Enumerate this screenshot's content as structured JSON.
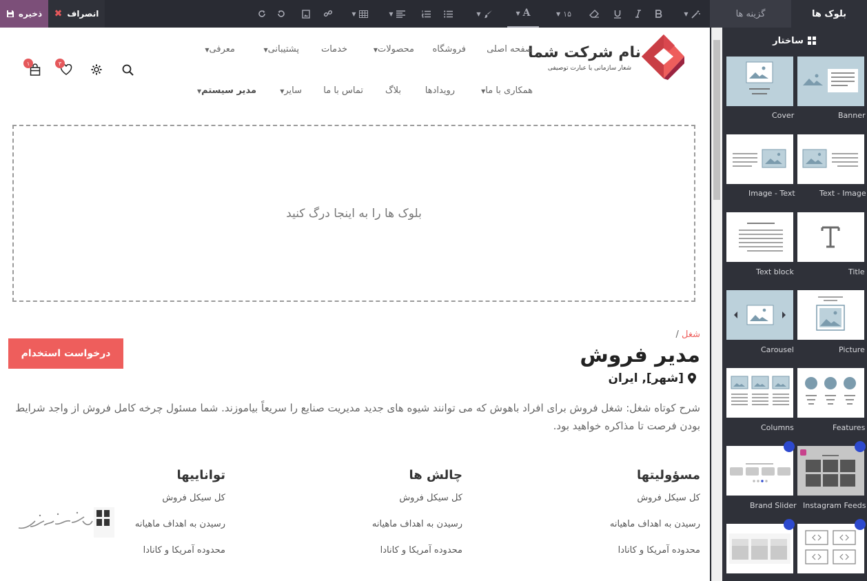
{
  "toolbar": {
    "save_label": "ذخیره",
    "cancel_label": "انصراف",
    "font_size": "۱۵",
    "font_icon": "A"
  },
  "panel": {
    "tab_blocks": "بلوک ها",
    "tab_options": "گزینه ها",
    "section_title": "ساختار",
    "snippets": [
      {
        "label": "Banner"
      },
      {
        "label": "Cover"
      },
      {
        "label": "Text - Image"
      },
      {
        "label": "Image - Text"
      },
      {
        "label": "Title"
      },
      {
        "label": "Text block"
      },
      {
        "label": "Picture"
      },
      {
        "label": "Carousel"
      },
      {
        "label": "Features"
      },
      {
        "label": "Columns"
      },
      {
        "label": "Instagram Feeds"
      },
      {
        "label": "Brand Slider"
      }
    ]
  },
  "header": {
    "logo_name": "نام شرکت شما",
    "logo_tagline": "شعار سازمانی یا عبارت توصیفی",
    "nav_row1": [
      "صفحه اصلی",
      "فروشگاه",
      "محصولات",
      "خدمات",
      "پشتیبانی",
      "معرفی"
    ],
    "nav_row2": [
      "همکاری با ما",
      "رویدادها",
      "بلاگ",
      "تماس با ما",
      "سایر",
      "مدیر سیستم"
    ],
    "cart_count": "۱",
    "wishlist_count": "۳"
  },
  "dropzone_text": "بلوک ها را به اینجا درگ کنید",
  "job": {
    "breadcrumb_link": "شغل",
    "breadcrumb_sep": "/",
    "title": "مدیر فروش",
    "location": "[شهر], ایران",
    "apply_label": "درخواست استخدام",
    "description": "شرح کوتاه شغل: شغل فروش برای افراد باهوش که می توانند شیوه های جدید مدیریت صنایع را سریعاً بیاموزند. شما مسئول چرخه کامل فروش از واجد شرایط بودن فرصت تا مذاکره خواهید بود.",
    "columns": [
      {
        "heading": "مسؤولیتها",
        "items": [
          "کل سیکل فروش",
          "رسیدن به اهداف ماهیانه",
          "محدوده آمریکا و کانادا"
        ]
      },
      {
        "heading": "چالش ها",
        "items": [
          "کل سیکل فروش",
          "رسیدن به اهداف ماهیانه",
          "محدوده آمریکا و کانادا"
        ]
      },
      {
        "heading": "تواناییها",
        "items": [
          "کل سیکل فروش",
          "رسیدن به اهداف ماهیانه",
          "محدوده آمریکا و کانادا"
        ]
      }
    ]
  },
  "colors": {
    "toolbar_bg": "#292b33",
    "save_bg": "#7c4f79",
    "panel_bg": "#2f3139",
    "accent_red": "#ee5e5c",
    "snippet_blue": "#bcd1db"
  }
}
